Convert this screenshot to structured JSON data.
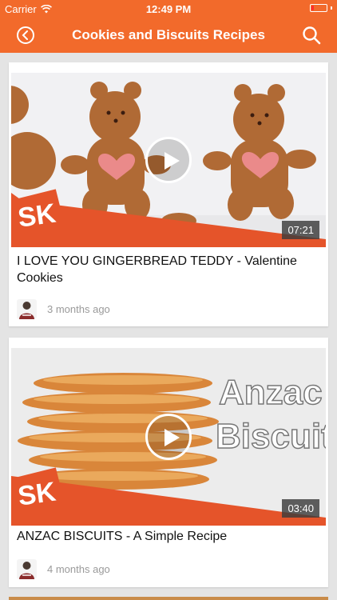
{
  "status_bar": {
    "carrier": "Carrier",
    "time": "12:49 PM",
    "battery_color": "#ff2d2d"
  },
  "nav": {
    "title": "Cookies and Biscuits Recipes",
    "back_icon": "chevron-left-circle-icon",
    "search_icon": "search-icon",
    "accent_color": "#f26a2b"
  },
  "videos": [
    {
      "title": "I LOVE YOU  GINGERBREAD TEDDY - Valentine Cookies",
      "duration": "07:21",
      "posted": "3 months ago",
      "logo_text": "SK"
    },
    {
      "title": "ANZAC BISCUITS - A Simple Recipe",
      "duration": "03:40",
      "posted": "4 months ago",
      "logo_text": "SK",
      "overlay_text": [
        "Anzac",
        "Biscuit"
      ]
    }
  ]
}
